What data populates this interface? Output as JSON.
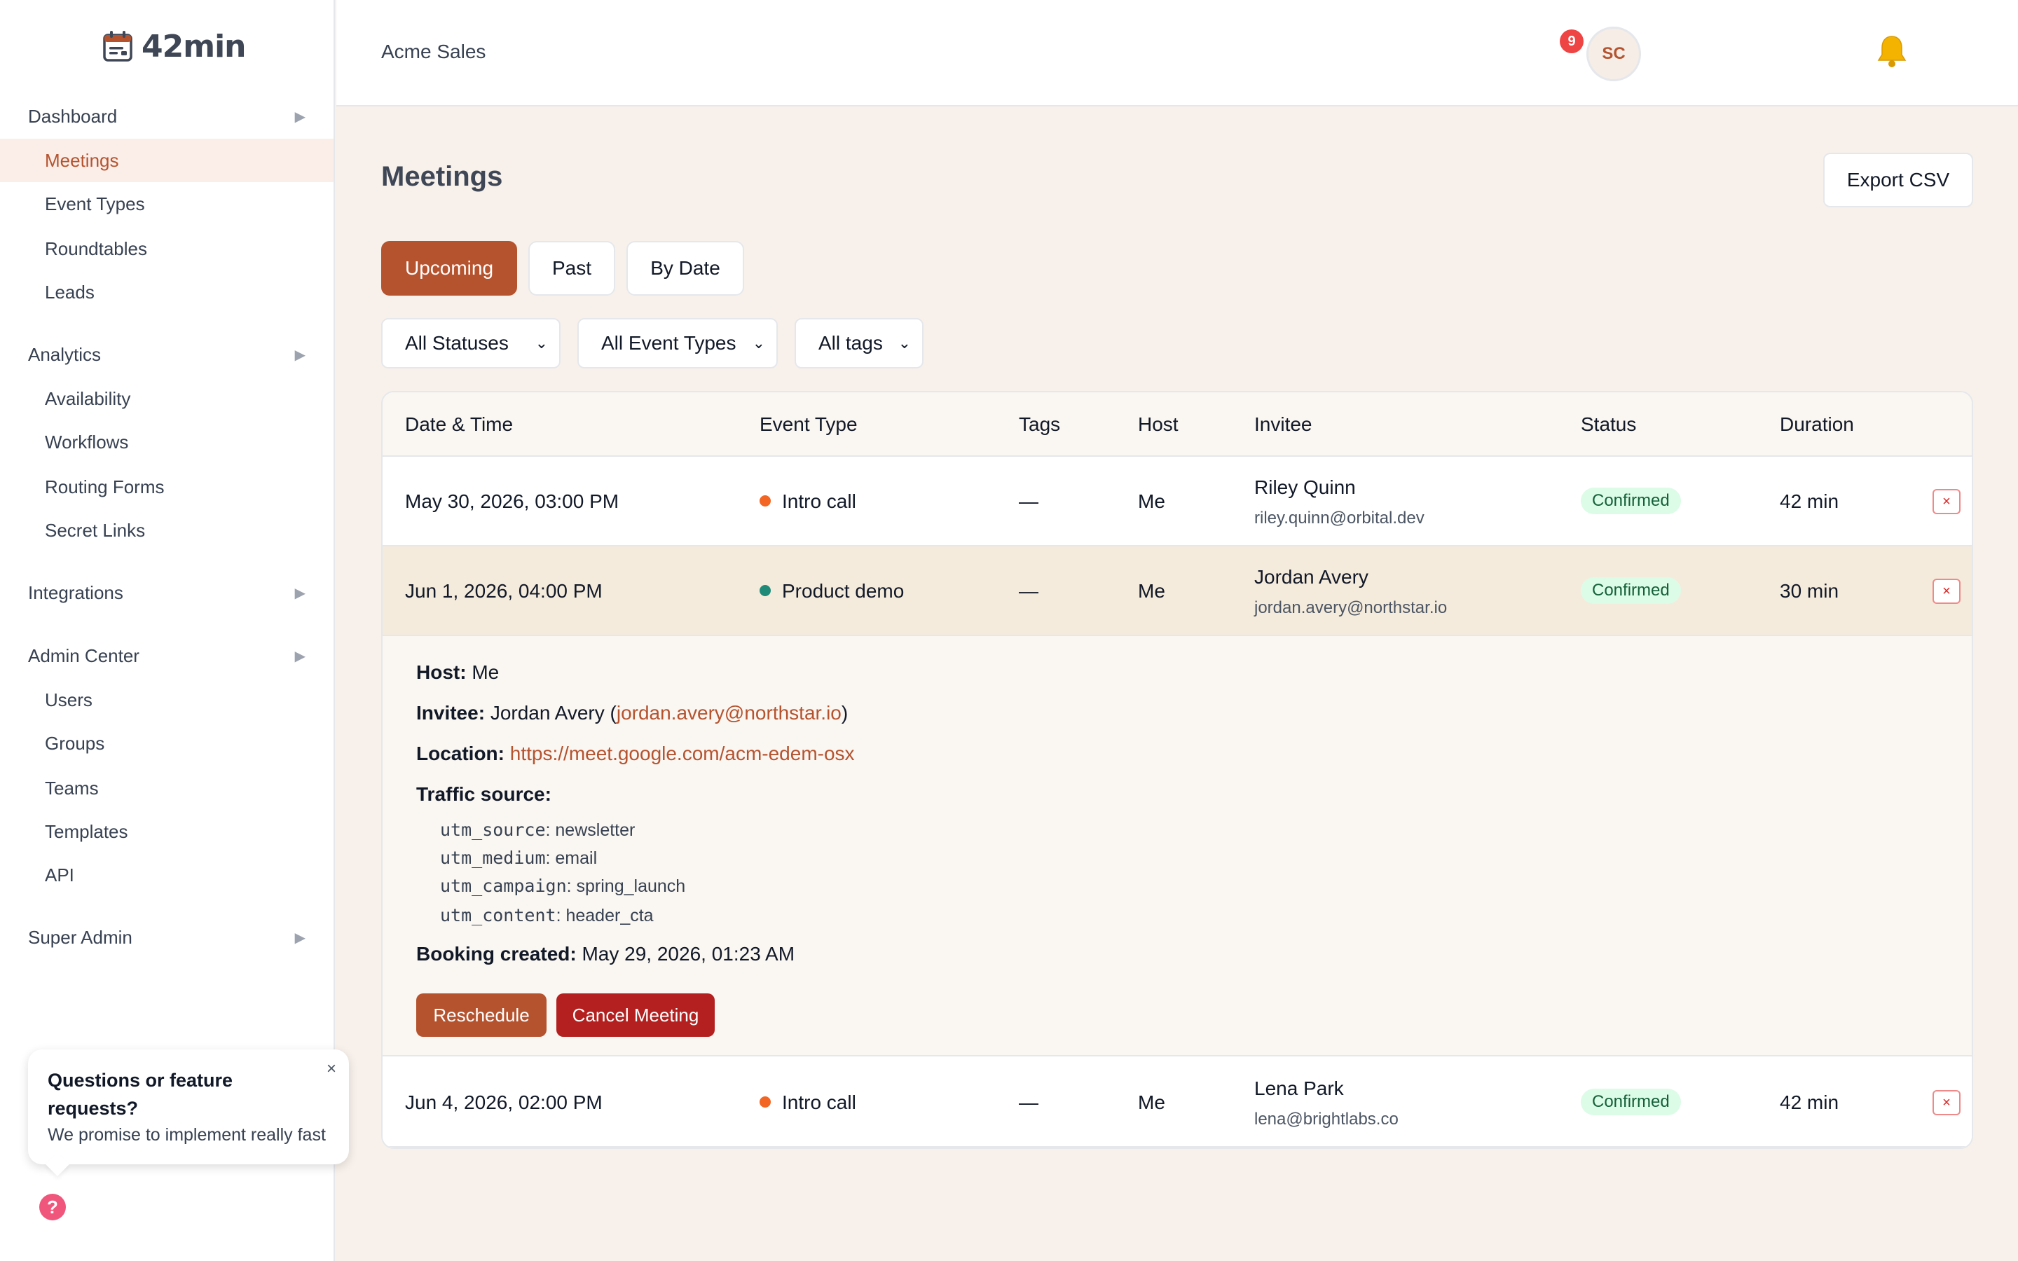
{
  "app": {
    "logo_text": "42min",
    "org_name": "Acme Sales"
  },
  "header": {
    "notification_count": "9",
    "avatar_initials": "SC"
  },
  "sidebar": {
    "sections": [
      {
        "label": "Dashboard",
        "items": [
          "Meetings",
          "Event Types",
          "Roundtables",
          "Leads"
        ]
      },
      {
        "label": "Analytics",
        "items": [
          "Availability",
          "Workflows",
          "Routing Forms",
          "Secret Links"
        ]
      },
      {
        "label": "Integrations",
        "items": []
      },
      {
        "label": "Admin Center",
        "items": [
          "Users",
          "Groups",
          "Teams",
          "Templates",
          "API"
        ]
      },
      {
        "label": "Super Admin",
        "items": []
      }
    ],
    "active_item": "Meetings",
    "arrow": "▶"
  },
  "popup": {
    "title": "Questions or feature requests?",
    "subtitle": "We promise to implement really fast",
    "close": "×"
  },
  "main": {
    "title": "Meetings",
    "export_label": "Export CSV",
    "tabs": [
      "Upcoming",
      "Past",
      "By Date"
    ],
    "active_tab": "Upcoming",
    "filters": [
      "All Statuses",
      "All Event Types",
      "All tags"
    ]
  },
  "table": {
    "columns": [
      "Date & Time",
      "Event Type",
      "Tags",
      "Host",
      "Invitee",
      "Status",
      "Duration"
    ],
    "rows": [
      {
        "datetime": "May 30, 2026, 03:00 PM",
        "event_type": "Intro call",
        "event_color": "#f26522",
        "tags": "—",
        "host": "Me",
        "invitee_name": "Riley Quinn",
        "invitee_email": "riley.quinn@orbital.dev",
        "status": "Confirmed",
        "duration": "42 min"
      },
      {
        "datetime": "Jun 1, 2026, 04:00 PM",
        "event_type": "Product demo",
        "event_color": "#1f8a78",
        "tags": "—",
        "host": "Me",
        "invitee_name": "Jordan Avery",
        "invitee_email": "jordan.avery@northstar.io",
        "status": "Confirmed",
        "duration": "30 min"
      },
      {
        "datetime": "Jun 4, 2026, 02:00 PM",
        "event_type": "Intro call",
        "event_color": "#f26522",
        "tags": "—",
        "host": "Me",
        "invitee_name": "Lena Park",
        "invitee_email": "lena@brightlabs.co",
        "status": "Confirmed",
        "duration": "42 min"
      }
    ],
    "delete_icon": "×"
  },
  "detail": {
    "host_label": "Host:",
    "host": "Me",
    "invitee_label": "Invitee:",
    "invitee_name": "Jordan Avery",
    "invitee_email": "jordan.avery@northstar.io",
    "location_label": "Location:",
    "location": "https://meet.google.com/acm-edem-osx",
    "traffic_label": "Traffic source:",
    "utm": [
      {
        "key": "utm_source",
        "value": ": newsletter"
      },
      {
        "key": "utm_medium",
        "value": ": email"
      },
      {
        "key": "utm_campaign",
        "value": ": spring_launch"
      },
      {
        "key": "utm_content",
        "value": ": header_cta"
      }
    ],
    "created_label": "Booking created:",
    "created": "May 29, 2026, 01:23 AM",
    "reschedule_label": "Reschedule",
    "cancel_label": "Cancel Meeting"
  },
  "colors": {
    "accent": "#b5532f",
    "danger": "#b3201f",
    "confirmed_bg": "#dcfce7"
  }
}
